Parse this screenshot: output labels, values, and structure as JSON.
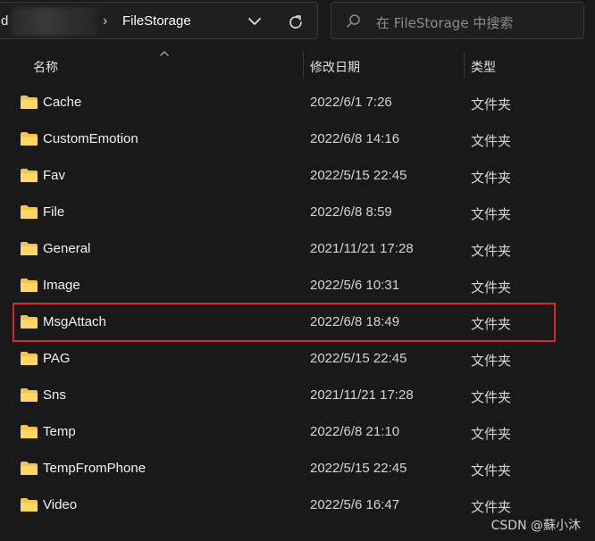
{
  "address_bar": {
    "prefix": "d",
    "separator": "›",
    "current_folder": "FileStorage"
  },
  "search": {
    "placeholder": "在 FileStorage 中搜索"
  },
  "columns": {
    "name": "名称",
    "date_modified": "修改日期",
    "type": "类型"
  },
  "files": [
    {
      "name": "Cache",
      "date": "2022/6/1 7:26",
      "type": "文件夹"
    },
    {
      "name": "CustomEmotion",
      "date": "2022/6/8 14:16",
      "type": "文件夹"
    },
    {
      "name": "Fav",
      "date": "2022/5/15 22:45",
      "type": "文件夹"
    },
    {
      "name": "File",
      "date": "2022/6/8 8:59",
      "type": "文件夹"
    },
    {
      "name": "General",
      "date": "2021/11/21 17:28",
      "type": "文件夹"
    },
    {
      "name": "Image",
      "date": "2022/5/6 10:31",
      "type": "文件夹"
    },
    {
      "name": "MsgAttach",
      "date": "2022/6/8 18:49",
      "type": "文件夹"
    },
    {
      "name": "PAG",
      "date": "2022/5/15 22:45",
      "type": "文件夹"
    },
    {
      "name": "Sns",
      "date": "2021/11/21 17:28",
      "type": "文件夹"
    },
    {
      "name": "Temp",
      "date": "2022/6/8 21:10",
      "type": "文件夹"
    },
    {
      "name": "TempFromPhone",
      "date": "2022/5/15 22:45",
      "type": "文件夹"
    },
    {
      "name": "Video",
      "date": "2022/5/6 16:47",
      "type": "文件夹"
    }
  ],
  "highlighted_item": "MsgAttach",
  "watermark": "CSDN @蘇小沐",
  "colors": {
    "background": "#191919",
    "folder": "#f6c544",
    "highlight": "#d9262c"
  },
  "icons": {
    "address_dropdown": "chevron-down-icon",
    "refresh": "refresh-icon",
    "search": "search-icon",
    "folder": "folder-icon",
    "sort": "sort-ascending-icon"
  }
}
